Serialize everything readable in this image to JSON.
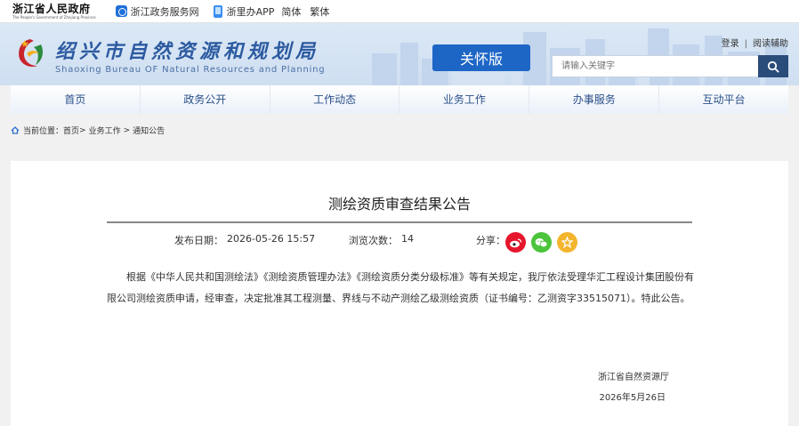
{
  "topbar": {
    "gov_name": "浙江省人民政府",
    "gov_name_en": "The People's Government of Zhejiang Province",
    "links": [
      "浙江政务服务网",
      "浙里办APP"
    ],
    "lang_simplified": "简体",
    "lang_traditional": "繁体"
  },
  "header": {
    "bureau_cn": "绍兴市自然资源和规划局",
    "bureau_en": "Shaoxing Bureau OF Natural Resources and Planning",
    "care_version": "关怀版",
    "login": "登录",
    "reading_aid": "阅读辅助",
    "search_placeholder": "请输入关键字",
    "search_icon": "search-icon"
  },
  "nav": {
    "items": [
      "首页",
      "政务公开",
      "工作动态",
      "业务工作",
      "办事服务",
      "互动平台"
    ]
  },
  "breadcrumb": {
    "prefix": "当前位置：",
    "home": "首页",
    "sep1": ">",
    "level2": "业务工作",
    "sep2": ">",
    "level3": "通知公告"
  },
  "article": {
    "title": "测绘资质审查结果公告",
    "publish_label": "发布日期：",
    "publish_date": "2026-05-26 15:57",
    "views_label": "浏览次数：",
    "views": "14",
    "share_label": "分享：",
    "body": "根据《中华人民共和国测绘法》《测绘资质管理办法》《测绘资质分类分级标准》等有关规定，我厅依法受理华汇工程设计集团股份有限公司测绘资质申请，经审查，决定批准其工程测量、界线与不动产测绘乙级测绘资质（证书编号：乙测资字33515071）。特此公告。",
    "sign_org": "浙江省自然资源厅",
    "sign_date": "2026年5月26日"
  },
  "colors": {
    "brand_blue": "#1d66c6",
    "nav_text": "#2a4f8a",
    "weibo": "#e6162d",
    "wechat": "#4cc43c",
    "favorite": "#f3b52e"
  }
}
